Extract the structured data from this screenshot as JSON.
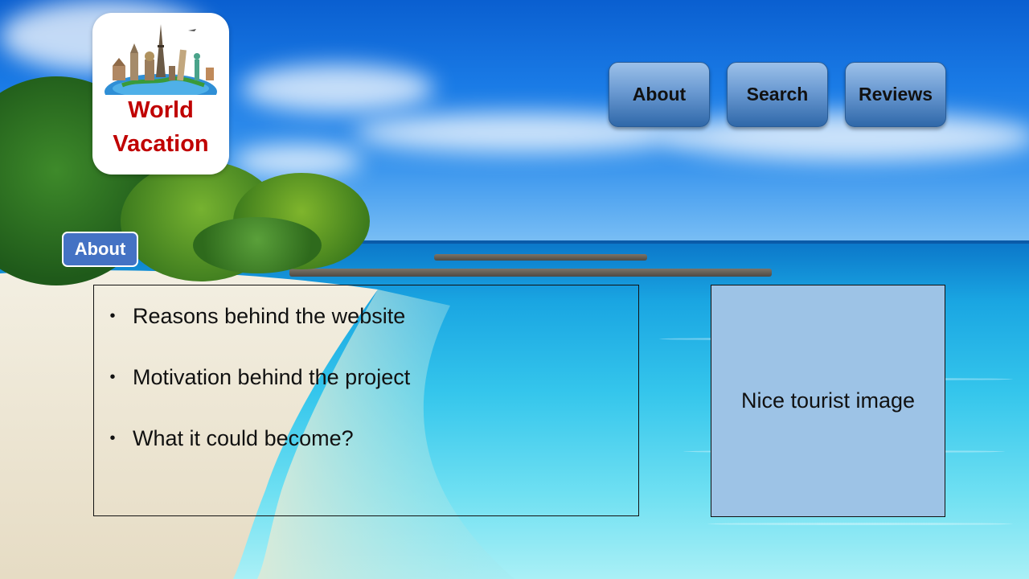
{
  "logo": {
    "line1": "World",
    "line2": "Vacation",
    "icon": "world-landmarks-globe-icon",
    "text_color": "#c00000"
  },
  "nav": {
    "items": [
      {
        "label": "About"
      },
      {
        "label": "Search"
      },
      {
        "label": "Reviews"
      }
    ],
    "button_color": "#5b8fd0"
  },
  "section": {
    "badge_label": "About",
    "badge_color": "#4472c4"
  },
  "content": {
    "bullets": [
      "Reasons behind the website",
      "Motivation behind the project",
      "What it could become?"
    ]
  },
  "image_placeholder": {
    "label": "Nice tourist image",
    "fill_color": "#9dc3e6"
  }
}
